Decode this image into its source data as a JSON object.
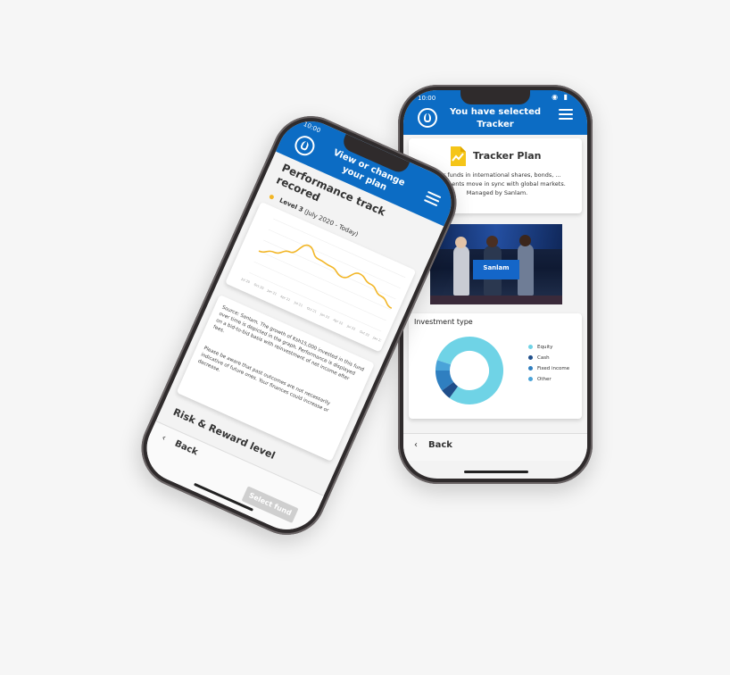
{
  "tracker_phone": {
    "status": {
      "time": "10:00",
      "icons": "◉ ▮"
    },
    "header": {
      "title": "You have selected Tracker"
    },
    "plan": {
      "title": "Tracker Plan",
      "description": "Your funds in international shares, bonds, ... investments move in sync with global markets. Managed by Sanlam."
    },
    "photo": {
      "banner_text": "Sanlam"
    },
    "investment": {
      "title": "Investment type",
      "legend": [
        {
          "label": "Equity",
          "color": "#6fd3e6",
          "value": 80
        },
        {
          "label": "Cash",
          "color": "#1f4e8a",
          "value": 5
        },
        {
          "label": "Fixed income",
          "color": "#2f7fc0",
          "value": 10
        },
        {
          "label": "Other",
          "color": "#4aa3d8",
          "value": 5
        }
      ]
    },
    "back_label": "Back"
  },
  "plan_phone": {
    "status": {
      "time": "10:00"
    },
    "header": {
      "title": "View or change your plan"
    },
    "performance": {
      "title": "Performance track recored",
      "level": "Level 3",
      "period": "(July 2020 - Today)",
      "line_color": "#f2b627"
    },
    "chart_data": {
      "type": "line",
      "x": [
        "Jul 20",
        "Oct 20",
        "Jan 21",
        "Apr 21",
        "Jul 21",
        "Oct 21",
        "Jan 22",
        "Apr 22",
        "Jul 22",
        "Oct 22",
        "Jan 23"
      ],
      "series": [
        {
          "values": [
            28,
            34,
            42,
            58,
            48,
            46,
            40,
            52,
            46,
            38,
            30
          ]
        }
      ],
      "ylim": [
        0,
        70
      ],
      "grid": true
    },
    "source_text": "Source: Sanlam. The growth of Ksh15,000 invested in this fund over time is depicted in the graph. Performance is displayed on a bid-to-bid basis with reinvestment of net income after fees.",
    "disclaimer": "Please be aware that past outcomes are not necessarily indicative of future ones. Your finances could increase or decrease.",
    "risk_title": "Risk & Reward level",
    "back_label": "Back",
    "select_label": "Select fund"
  }
}
